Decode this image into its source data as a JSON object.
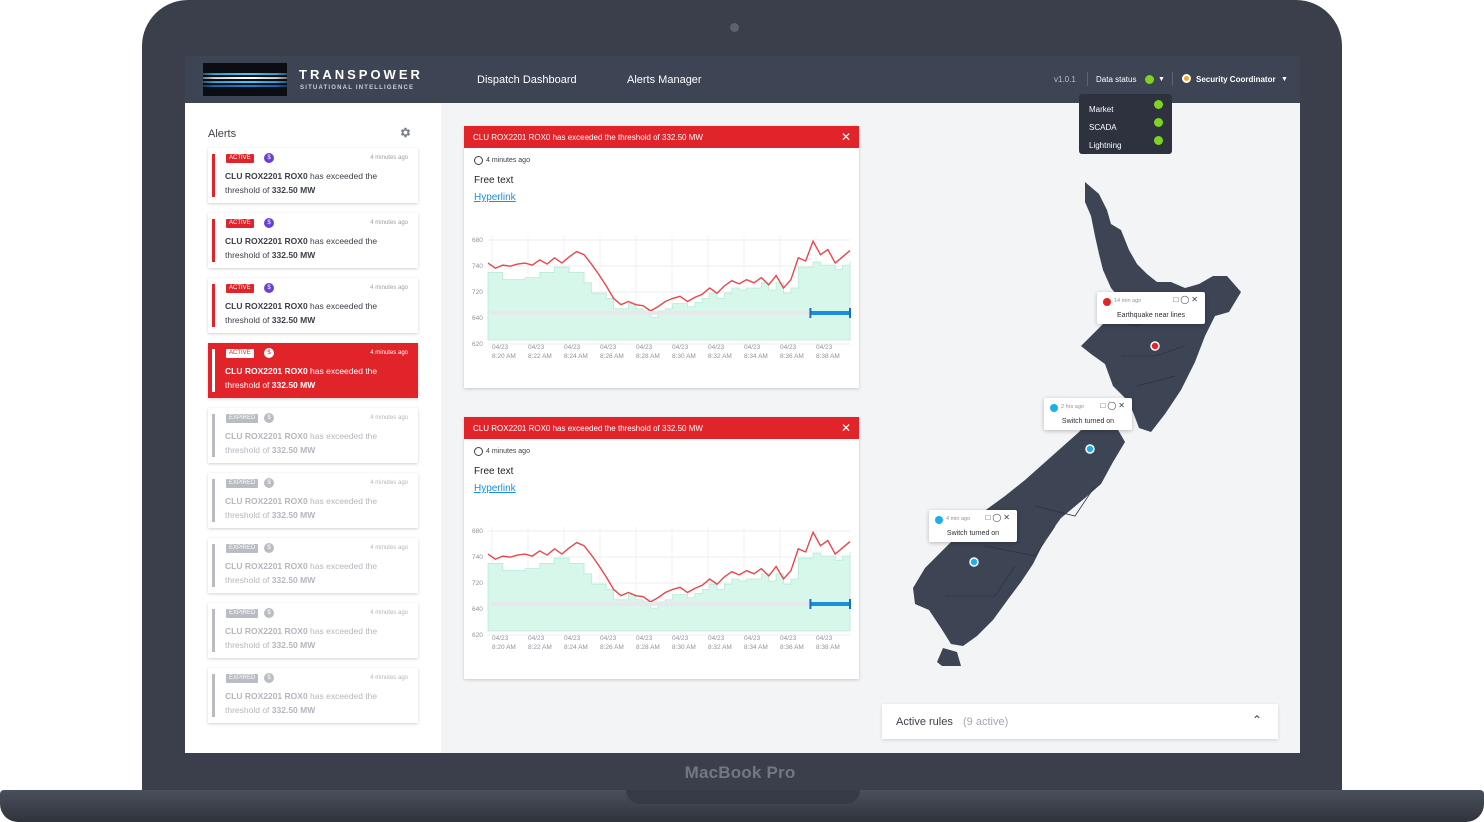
{
  "device": {
    "label": "MacBook Pro"
  },
  "header": {
    "brand_name": "TRANSPOWER",
    "brand_sub": "SITUATIONAL INTELLIGENCE",
    "nav": [
      "Dispatch Dashboard",
      "Alerts Manager"
    ],
    "version": "v1.0.1",
    "data_status_label": "Data status",
    "user": "Security Coordinator"
  },
  "data_status_menu": [
    {
      "label": "Market",
      "status": "ok"
    },
    {
      "label": "SCADA",
      "status": "ok"
    },
    {
      "label": "Lightning",
      "status": "ok"
    }
  ],
  "sidebar": {
    "title": "Alerts",
    "alerts": [
      {
        "status": "ACTIVE",
        "kind_icon": "$",
        "time": "4 minutes ago",
        "name": "CLU ROX2201 ROX0",
        "text": " has exceeded the threshold of ",
        "value": "332.50 MW",
        "state": "active"
      },
      {
        "status": "ACTIVE",
        "kind_icon": "$",
        "time": "4 minutes ago",
        "name": "CLU ROX2201 ROX0",
        "text": " has exceeded the threshold of ",
        "value": "332.50 MW",
        "state": "active"
      },
      {
        "status": "ACTIVE",
        "kind_icon": "$",
        "time": "4 minutes ago",
        "name": "CLU ROX2201 ROX0",
        "text": " has exceeded the threshold of ",
        "value": "332.50 MW",
        "state": "active"
      },
      {
        "status": "ACTIVE",
        "kind_icon": "$",
        "time": "4 minutes ago",
        "name": "CLU ROX2201 ROX0",
        "text": " has exceeded the threshold of ",
        "value": "332.50 MW",
        "state": "selected"
      },
      {
        "status": "EXPIRED",
        "kind_icon": "$",
        "time": "4 minutes ago",
        "name": "CLU ROX2201 ROX0",
        "text": " has exceeded the threshold of ",
        "value": "332.50 MW",
        "state": "expired"
      },
      {
        "status": "EXPIRED",
        "kind_icon": "$",
        "time": "4 minutes ago",
        "name": "CLU ROX2201 ROX0",
        "text": " has exceeded the threshold of ",
        "value": "332.50 MW",
        "state": "expired"
      },
      {
        "status": "EXPIRED",
        "kind_icon": "$",
        "time": "4 minutes ago",
        "name": "CLU ROX2201 ROX0",
        "text": " has exceeded the threshold of ",
        "value": "332.50 MW",
        "state": "expired"
      },
      {
        "status": "EXPIRED",
        "kind_icon": "$",
        "time": "4 minutes ago",
        "name": "CLU ROX2201 ROX0",
        "text": " has exceeded the threshold of ",
        "value": "332.50 MW",
        "state": "expired"
      },
      {
        "status": "EXPIRED",
        "kind_icon": "$",
        "time": "4 minutes ago",
        "name": "CLU ROX2201 ROX0",
        "text": " has exceeded the threshold of ",
        "value": "332.50 MW",
        "state": "expired"
      }
    ]
  },
  "panels": [
    {
      "title": "CLU ROX2201 ROX0 has exceeded the threshold of 332.50 MW",
      "time": "4 minutes ago",
      "free_text": "Free text",
      "link": "Hyperlink"
    },
    {
      "title": "CLU ROX2201 ROX0 has exceeded the threshold of 332.50 MW",
      "time": "4 minutes ago",
      "free_text": "Free text",
      "link": "Hyperlink"
    }
  ],
  "chart_data": [
    {
      "type": "line",
      "title": "",
      "xlabel": "",
      "ylabel": "",
      "y_ticks": [
        "680",
        "740",
        "720",
        "640",
        "620"
      ],
      "x_labels": [
        "04/23\n8:20 AM",
        "04/23\n8:22 AM",
        "04/23\n8:24 AM",
        "04/23\n8:26 AM",
        "04/23\n8:28 AM",
        "04/23\n8:30 AM",
        "04/23\n8:32 AM",
        "04/23\n8:34 AM",
        "04/23\n8:36 AM",
        "04/23\n8:38 AM"
      ],
      "series": [
        {
          "kind": "line",
          "color": "#e8474c",
          "values": [
            0.74,
            0.69,
            0.72,
            0.71,
            0.73,
            0.74,
            0.72,
            0.77,
            0.73,
            0.79,
            0.74,
            0.8,
            0.85,
            0.82,
            0.73,
            0.63,
            0.52,
            0.4,
            0.34,
            0.37,
            0.34,
            0.33,
            0.28,
            0.32,
            0.37,
            0.4,
            0.42,
            0.37,
            0.41,
            0.44,
            0.5,
            0.45,
            0.52,
            0.57,
            0.54,
            0.58,
            0.55,
            0.6,
            0.53,
            0.62,
            0.5,
            0.58,
            0.79,
            0.76,
            0.95,
            0.82,
            0.87,
            0.74,
            0.8,
            0.86
          ]
        },
        {
          "kind": "area",
          "color": "#d6f7ea",
          "values": [
            0.65,
            0.65,
            0.58,
            0.58,
            0.58,
            0.6,
            0.6,
            0.65,
            0.65,
            0.7,
            0.7,
            0.65,
            0.65,
            0.55,
            0.45,
            0.45,
            0.4,
            0.3,
            0.3,
            0.35,
            0.3,
            0.28,
            0.22,
            0.28,
            0.3,
            0.35,
            0.35,
            0.32,
            0.36,
            0.4,
            0.45,
            0.4,
            0.45,
            0.5,
            0.48,
            0.5,
            0.5,
            0.55,
            0.48,
            0.55,
            0.45,
            0.5,
            0.7,
            0.7,
            0.75,
            0.72,
            0.72,
            0.68,
            0.72,
            0.76
          ]
        }
      ],
      "range_selector": [
        0.89,
        1.0
      ]
    },
    {
      "type": "line",
      "title": "",
      "xlabel": "",
      "ylabel": "",
      "y_ticks": [
        "680",
        "740",
        "720",
        "640",
        "620"
      ],
      "x_labels": [
        "04/23\n8:20 AM",
        "04/23\n8:22 AM",
        "04/23\n8:24 AM",
        "04/23\n8:26 AM",
        "04/23\n8:28 AM",
        "04/23\n8:30 AM",
        "04/23\n8:32 AM",
        "04/23\n8:34 AM",
        "04/23\n8:36 AM",
        "04/23\n8:38 AM"
      ],
      "series": [
        {
          "kind": "line",
          "color": "#e8474c",
          "values": [
            0.74,
            0.69,
            0.72,
            0.71,
            0.73,
            0.74,
            0.72,
            0.77,
            0.73,
            0.79,
            0.74,
            0.8,
            0.85,
            0.82,
            0.73,
            0.63,
            0.52,
            0.4,
            0.34,
            0.37,
            0.34,
            0.33,
            0.28,
            0.32,
            0.37,
            0.4,
            0.42,
            0.37,
            0.41,
            0.44,
            0.5,
            0.45,
            0.52,
            0.57,
            0.54,
            0.58,
            0.55,
            0.6,
            0.53,
            0.62,
            0.5,
            0.58,
            0.79,
            0.76,
            0.95,
            0.82,
            0.87,
            0.74,
            0.8,
            0.86
          ]
        },
        {
          "kind": "area",
          "color": "#d6f7ea",
          "values": [
            0.65,
            0.65,
            0.58,
            0.58,
            0.58,
            0.6,
            0.6,
            0.65,
            0.65,
            0.7,
            0.7,
            0.65,
            0.65,
            0.55,
            0.45,
            0.45,
            0.4,
            0.3,
            0.3,
            0.35,
            0.3,
            0.28,
            0.22,
            0.28,
            0.3,
            0.35,
            0.35,
            0.32,
            0.36,
            0.4,
            0.45,
            0.4,
            0.45,
            0.5,
            0.48,
            0.5,
            0.5,
            0.55,
            0.48,
            0.55,
            0.45,
            0.5,
            0.7,
            0.7,
            0.75,
            0.72,
            0.72,
            0.68,
            0.72,
            0.76
          ]
        }
      ],
      "range_selector": [
        0.89,
        1.0
      ]
    }
  ],
  "map": {
    "popups": [
      {
        "time": "14 min ago",
        "text": "Earthquake near lines",
        "color": "#e0242a"
      },
      {
        "time": "2 hrs ago",
        "text": "Switch turned on",
        "color": "#1ab0e8"
      },
      {
        "time": "4 min ago",
        "text": "Switch turned on",
        "color": "#1ab0e8"
      }
    ]
  },
  "active_rules": {
    "label": "Active rules",
    "count": "(9 active)"
  },
  "colors": {
    "alert_red": "#e0242a",
    "status_ok": "#7ed321",
    "header_bg": "#3d4453",
    "link_blue": "#1a8fe0"
  }
}
